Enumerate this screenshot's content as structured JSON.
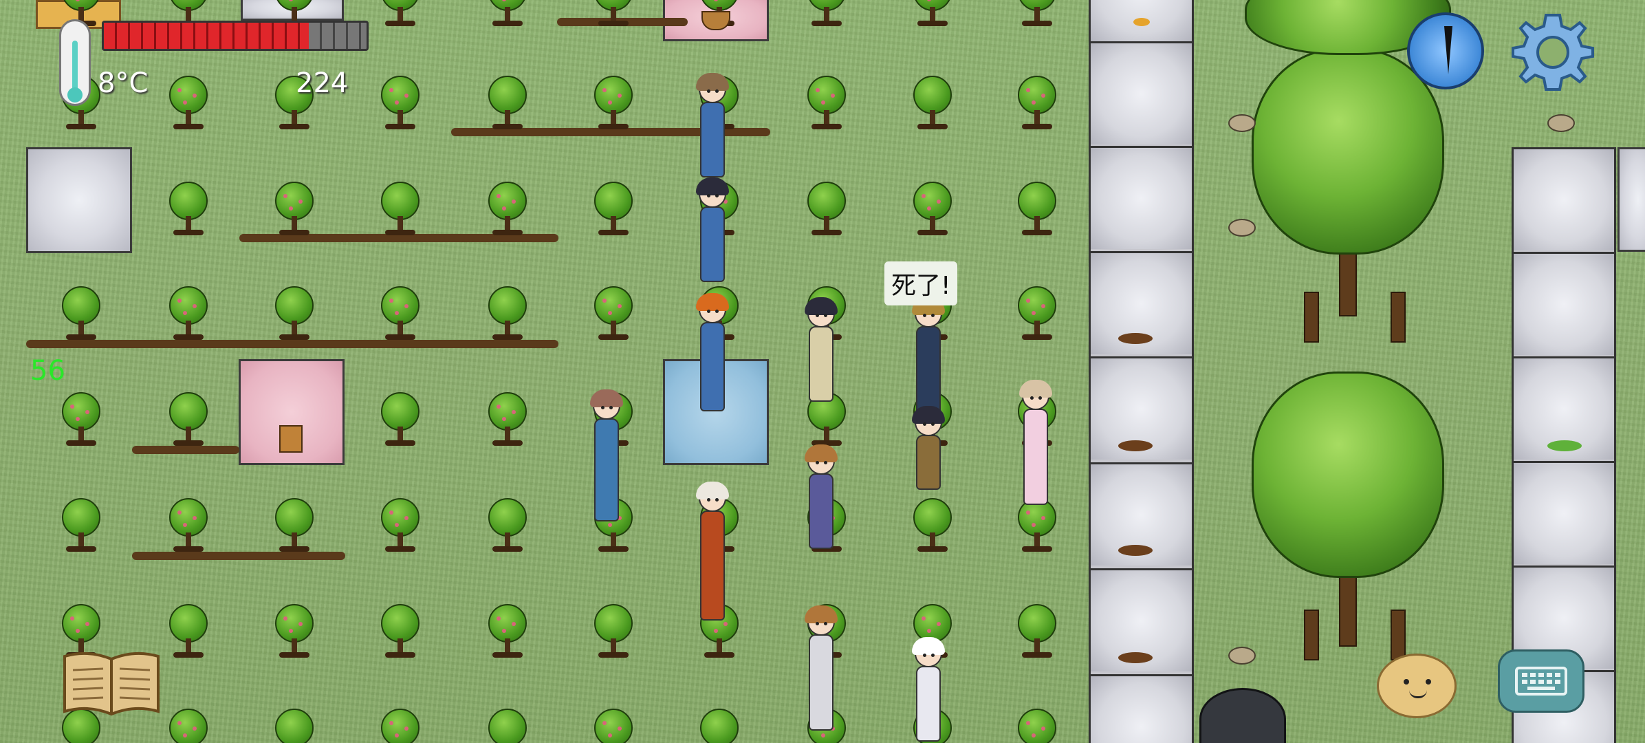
{
  "hud": {
    "temperature": "8°C",
    "count": "224",
    "age": "56",
    "health_fraction": 0.78
  },
  "speech": {
    "text": "死了!"
  },
  "icons": {
    "thermometer": "thermometer-icon",
    "compass": "compass-icon",
    "settings": "gear-icon",
    "book": "book-icon",
    "emote": "smiley-face-icon",
    "keyboard": "keyboard-icon"
  },
  "colors": {
    "health": "#e0262b",
    "age": "#29e829",
    "grass": "#8db06e"
  }
}
